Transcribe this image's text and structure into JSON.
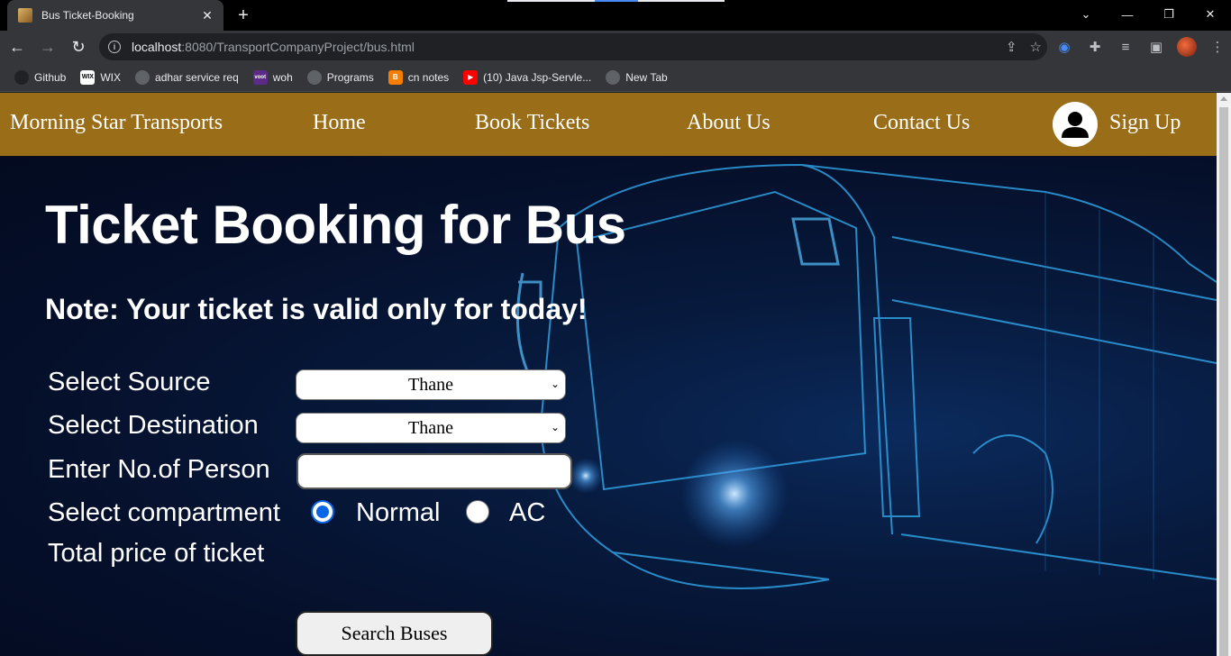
{
  "browser": {
    "tab_title": "Bus Ticket-Booking",
    "tab_close": "✕",
    "new_tab": "+",
    "url_host": "localhost",
    "url_rest": ":8080/TransportCompanyProject/bus.html",
    "window_controls": [
      "⌄",
      "—",
      "❐",
      "✕"
    ],
    "bookmarks": [
      {
        "label": "Github",
        "icon": "github-icon"
      },
      {
        "label": "WIX",
        "icon": "wix-icon",
        "mark": "WIX"
      },
      {
        "label": "adhar service req",
        "icon": "globe-icon"
      },
      {
        "label": "woh",
        "icon": "voot-icon",
        "mark": "voot"
      },
      {
        "label": "Programs",
        "icon": "globe-icon"
      },
      {
        "label": "cn notes",
        "icon": "blogger-icon",
        "mark": "B"
      },
      {
        "label": "(10) Java Jsp-Servle...",
        "icon": "youtube-icon",
        "mark": "▶"
      },
      {
        "label": "New Tab",
        "icon": "globe-icon"
      }
    ]
  },
  "navbar": {
    "brand": "Morning Star Transports",
    "home": "Home",
    "book": "Book Tickets",
    "about": "About Us",
    "contact": "Contact Us",
    "signup": "Sign Up",
    "bg_color": "#9a6e19"
  },
  "main": {
    "heading": "Ticket Booking for Bus",
    "note": "Note: Your ticket is valid only for today!",
    "form": {
      "source_label": "Select Source",
      "source_value": "Thane",
      "destination_label": "Select Destination",
      "destination_value": "Thane",
      "persons_label": "Enter No.of Person",
      "persons_value": "",
      "compartment_label": "Select compartment",
      "option_normal": "Normal",
      "option_ac": "AC",
      "selected_compartment": "Normal",
      "price_label": "Total price of ticket",
      "search_button": "Search Buses"
    }
  }
}
